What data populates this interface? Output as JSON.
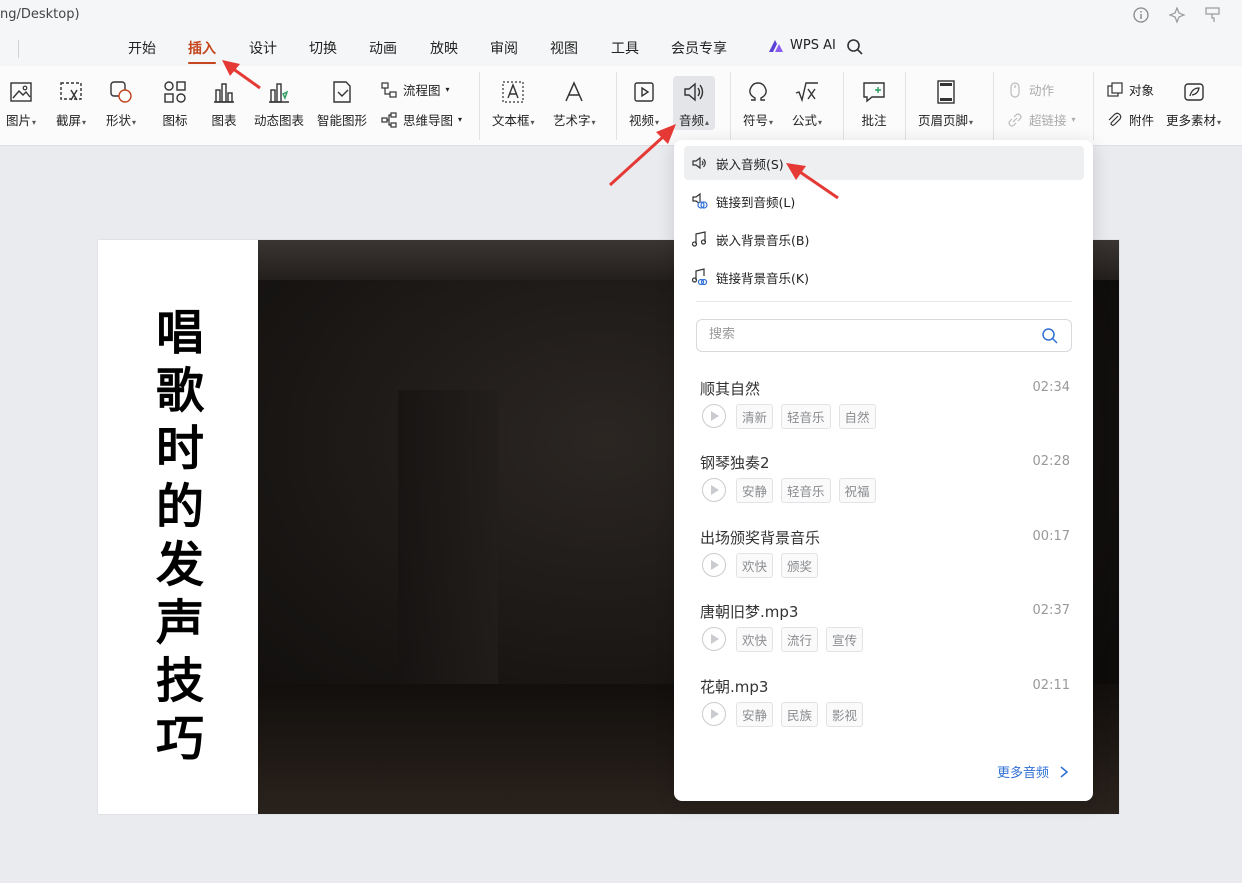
{
  "window": {
    "path_fragment": "ng/Desktop)"
  },
  "menu": {
    "tabs": [
      "开始",
      "插入",
      "设计",
      "切换",
      "动画",
      "放映",
      "审阅",
      "视图",
      "工具",
      "会员专享"
    ],
    "active_tab": "插入",
    "wps_ai": "WPS AI"
  },
  "ribbon": {
    "picture": "图片",
    "screenshot": "截屏",
    "shape": "形状",
    "icon": "图标",
    "chart": "图表",
    "dynamic_chart": "动态图表",
    "smart_graphic": "智能图形",
    "flowchart": "流程图",
    "mindmap": "思维导图",
    "textbox": "文本框",
    "wordart": "艺术字",
    "video": "视频",
    "audio": "音频",
    "symbol": "符号",
    "formula": "公式",
    "comment": "批注",
    "header_footer": "页眉页脚",
    "action": "动作",
    "hyperlink": "超链接",
    "object": "对象",
    "attachment": "附件",
    "more_material": "更多素材"
  },
  "slide": {
    "title": "唱歌时的发声技巧"
  },
  "audio_menu": {
    "embed_audio": "嵌入音频(S)",
    "link_audio": "链接到音频(L)",
    "embed_bg_music": "嵌入背景音乐(B)",
    "link_bg_music": "链接背景音乐(K)",
    "search_placeholder": "搜索",
    "songs": [
      {
        "name": "顺其自然",
        "duration": "02:34",
        "tags": [
          "清新",
          "轻音乐",
          "自然"
        ]
      },
      {
        "name": "钢琴独奏2",
        "duration": "02:28",
        "tags": [
          "安静",
          "轻音乐",
          "祝福"
        ]
      },
      {
        "name": "出场颁奖背景音乐",
        "duration": "00:17",
        "tags": [
          "欢快",
          "颁奖"
        ]
      },
      {
        "name": "唐朝旧梦.mp3",
        "duration": "02:37",
        "tags": [
          "欢快",
          "流行",
          "宣传"
        ]
      },
      {
        "name": "花朝.mp3",
        "duration": "02:11",
        "tags": [
          "安静",
          "民族",
          "影视"
        ]
      }
    ],
    "more_audio": "更多音频"
  },
  "colors": {
    "accent": "#c5461e",
    "link": "#2f6fd6",
    "annotation": "#e53935"
  }
}
